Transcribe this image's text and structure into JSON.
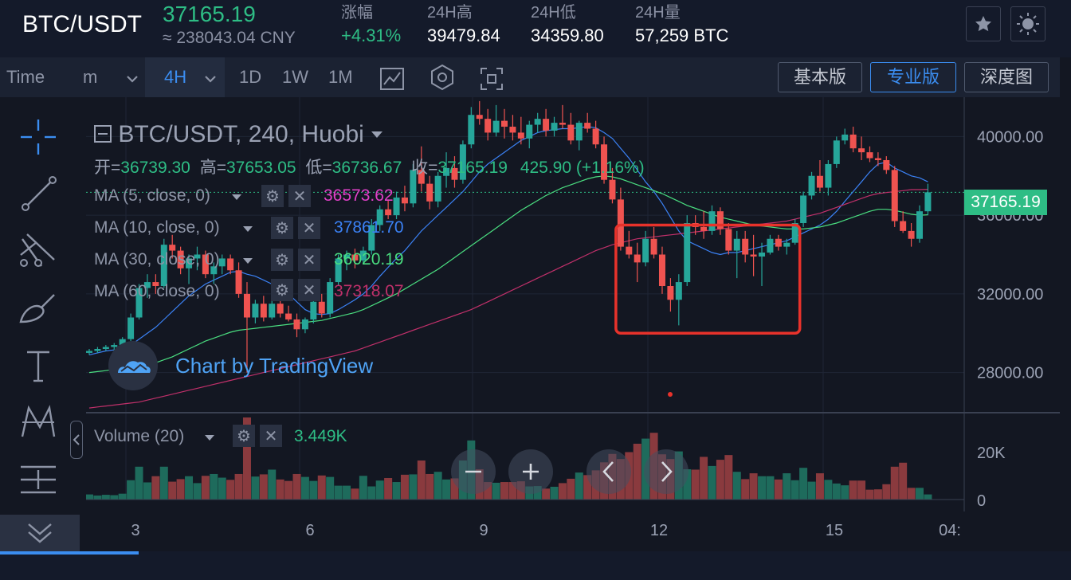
{
  "header": {
    "pair": "BTC/USDT",
    "last_price": "37165.19",
    "cny": "≈ 238043.04 CNY",
    "stats": [
      {
        "label": "涨幅",
        "value": "+4.31%",
        "color": "#2ebd85"
      },
      {
        "label": "24H高",
        "value": "39479.84",
        "color": "#ffffff"
      },
      {
        "label": "24H低",
        "value": "34359.80",
        "color": "#ffffff"
      },
      {
        "label": "24H量",
        "value": "57,259 BTC",
        "color": "#ffffff"
      }
    ]
  },
  "toolbar": {
    "time_label": "Time",
    "minute_label": "m",
    "interval_selected": "4H",
    "intervals": [
      "1D",
      "1W",
      "1M"
    ],
    "views": [
      "基本版",
      "专业版",
      "深度图"
    ],
    "active_view": "专业版"
  },
  "chart": {
    "title": "BTC/USDT, 240, Huobi",
    "ohlc": {
      "open_label": "开=",
      "open": "36739.30",
      "high_label": "高=",
      "high": "37653.05",
      "low_label": "低=",
      "low": "36736.67",
      "close_label": "收=",
      "close": "37165.19",
      "change": "425.90 (+1.16%)"
    },
    "ma": [
      {
        "label": "MA (5, close, 0)",
        "value": "36573.62",
        "color": "#e040c8"
      },
      {
        "label": "MA (10, close, 0)",
        "value": "37861.70",
        "color": "#3b82f6"
      },
      {
        "label": "MA (30, close, 0)",
        "value": "36020.19",
        "color": "#4ade80"
      },
      {
        "label": "MA (60, close, 0)",
        "value": "37318.07",
        "color": "#c0306a"
      }
    ],
    "watermark": "Chart by TradingView",
    "volume_label": "Volume (20)",
    "volume_value": "3.449K",
    "price_ticks": [
      "40000.00",
      "36000.00",
      "32000.00",
      "28000.00"
    ],
    "price_tag": "37165.19",
    "volume_ticks": [
      "20K",
      "0"
    ],
    "x_ticks": [
      "3",
      "6",
      "9",
      "12",
      "15",
      "04:"
    ]
  },
  "chart_data": {
    "type": "candlestick",
    "ylim": [
      26000,
      42000
    ],
    "candles": [
      [
        29000,
        29200,
        28900,
        29100
      ],
      [
        29100,
        29300,
        29000,
        29200
      ],
      [
        29200,
        29400,
        29100,
        29300
      ],
      [
        29300,
        29500,
        29100,
        29400
      ],
      [
        29400,
        29800,
        29300,
        29700
      ],
      [
        29700,
        31000,
        29600,
        30800
      ],
      [
        30800,
        32500,
        30700,
        32300
      ],
      [
        32300,
        33000,
        31800,
        32600
      ],
      [
        32600,
        33000,
        32000,
        32400
      ],
      [
        32400,
        34800,
        32300,
        34500
      ],
      [
        34500,
        35000,
        33800,
        34200
      ],
      [
        34200,
        34400,
        33000,
        33300
      ],
      [
        33300,
        34000,
        32500,
        33800
      ],
      [
        33800,
        34400,
        33200,
        34000
      ],
      [
        34000,
        34200,
        32800,
        33000
      ],
      [
        33000,
        33600,
        32500,
        33400
      ],
      [
        33400,
        34000,
        33000,
        33800
      ],
      [
        33800,
        34000,
        33000,
        33200
      ],
      [
        33200,
        33600,
        31800,
        32000
      ],
      [
        32000,
        32600,
        28000,
        30800
      ],
      [
        30800,
        31700,
        30500,
        31500
      ],
      [
        31500,
        31900,
        30600,
        30800
      ],
      [
        30800,
        31700,
        30700,
        31500
      ],
      [
        31500,
        31800,
        30800,
        31000
      ],
      [
        31000,
        31400,
        30600,
        30700
      ],
      [
        30700,
        31000,
        29800,
        30200
      ],
      [
        30200,
        30800,
        30000,
        30700
      ],
      [
        30700,
        31800,
        30500,
        31600
      ],
      [
        31600,
        32000,
        30800,
        31000
      ],
      [
        31000,
        32800,
        30800,
        32600
      ],
      [
        32600,
        34000,
        32400,
        33800
      ],
      [
        33800,
        34200,
        33200,
        34000
      ],
      [
        34000,
        34300,
        33300,
        33700
      ],
      [
        33700,
        34400,
        33500,
        34200
      ],
      [
        34200,
        35800,
        34000,
        35500
      ],
      [
        35500,
        36500,
        35200,
        36300
      ],
      [
        36300,
        36800,
        35800,
        36000
      ],
      [
        36000,
        37200,
        35800,
        36900
      ],
      [
        36900,
        37500,
        36200,
        36600
      ],
      [
        36600,
        38600,
        36400,
        38300
      ],
      [
        38300,
        39500,
        37200,
        37600
      ],
      [
        37600,
        38000,
        36300,
        36700
      ],
      [
        36700,
        38200,
        36400,
        38000
      ],
      [
        38000,
        39200,
        37400,
        38400
      ],
      [
        38400,
        39000,
        37400,
        37800
      ],
      [
        37800,
        39800,
        37600,
        39600
      ],
      [
        39600,
        41500,
        39400,
        41100
      ],
      [
        41100,
        41800,
        40600,
        40900
      ],
      [
        40900,
        41400,
        39800,
        40200
      ],
      [
        40200,
        41600,
        40000,
        40800
      ],
      [
        40800,
        41400,
        39900,
        40500
      ],
      [
        40500,
        41100,
        39800,
        40200
      ],
      [
        40200,
        41000,
        39600,
        39900
      ],
      [
        39900,
        40800,
        39400,
        40600
      ],
      [
        40600,
        41200,
        40200,
        40900
      ],
      [
        40900,
        41400,
        40000,
        40300
      ],
      [
        40300,
        41000,
        40000,
        40700
      ],
      [
        40700,
        41600,
        40400,
        40600
      ],
      [
        40600,
        41200,
        39600,
        39800
      ],
      [
        39800,
        40800,
        39300,
        40700
      ],
      [
        40700,
        41200,
        40200,
        40400
      ],
      [
        40400,
        40800,
        39400,
        39600
      ],
      [
        39600,
        40000,
        37600,
        37800
      ],
      [
        37800,
        38400,
        36600,
        36800
      ],
      [
        36800,
        37400,
        34200,
        34400
      ],
      [
        34400,
        35200,
        33800,
        34000
      ],
      [
        34000,
        34600,
        32600,
        33600
      ],
      [
        33600,
        35200,
        33400,
        34800
      ],
      [
        34800,
        35400,
        33800,
        34000
      ],
      [
        34000,
        34400,
        32000,
        32400
      ],
      [
        32400,
        32800,
        31100,
        31700
      ],
      [
        31700,
        33000,
        30400,
        32600
      ],
      [
        32600,
        36000,
        32400,
        35600
      ],
      [
        35600,
        36000,
        35000,
        35400
      ],
      [
        35400,
        36200,
        34800,
        35200
      ],
      [
        35200,
        36500,
        35000,
        36200
      ],
      [
        36200,
        36400,
        35000,
        35300
      ],
      [
        35300,
        35600,
        34000,
        34200
      ],
      [
        34200,
        35200,
        32800,
        34800
      ],
      [
        34800,
        35200,
        33600,
        34000
      ],
      [
        34000,
        35000,
        32900,
        33900
      ],
      [
        33900,
        34600,
        32400,
        34100
      ],
      [
        34100,
        35000,
        34000,
        34800
      ],
      [
        34800,
        35000,
        34200,
        34400
      ],
      [
        34400,
        34800,
        34000,
        34600
      ],
      [
        34600,
        35800,
        34500,
        35600
      ],
      [
        35600,
        37200,
        35400,
        37000
      ],
      [
        37000,
        38200,
        36800,
        38000
      ],
      [
        38000,
        38800,
        37200,
        37400
      ],
      [
        37400,
        38800,
        37000,
        38600
      ],
      [
        38600,
        40000,
        38400,
        39800
      ],
      [
        39800,
        40400,
        39600,
        40100
      ],
      [
        40100,
        40500,
        39200,
        39400
      ],
      [
        39400,
        40000,
        38800,
        39200
      ],
      [
        39200,
        39500,
        38700,
        38900
      ],
      [
        38900,
        39200,
        38500,
        38800
      ],
      [
        38800,
        39000,
        38100,
        38300
      ],
      [
        38300,
        38500,
        35400,
        35700
      ],
      [
        35700,
        36200,
        35100,
        35200
      ],
      [
        35200,
        35600,
        34400,
        34800
      ],
      [
        34800,
        36500,
        34600,
        36200
      ],
      [
        36200,
        37600,
        36000,
        37165
      ]
    ],
    "volumes": [
      1400,
      1100,
      1300,
      1200,
      1600,
      5300,
      9000,
      4700,
      6400,
      9000,
      4900,
      5600,
      6400,
      4500,
      6500,
      7000,
      6000,
      5400,
      7000,
      22500,
      6300,
      6900,
      8200,
      5500,
      5100,
      7000,
      6200,
      5100,
      6600,
      6200,
      3800,
      3800,
      3000,
      6500,
      3600,
      5200,
      5900,
      4800,
      6800,
      6900,
      10700,
      7000,
      7600,
      5500,
      5800,
      10700,
      16200,
      8300,
      4800,
      4600,
      4800,
      4800,
      5000,
      3600,
      3700,
      3000,
      3500,
      4500,
      5700,
      7400,
      6700,
      8000,
      10200,
      12500,
      11100,
      13000,
      15300,
      16700,
      18300,
      12400,
      11100,
      13200,
      8300,
      8200,
      11700,
      9200,
      10900,
      12200,
      7600,
      5600,
      7200,
      6400,
      6400,
      5500,
      7200,
      5300,
      8700,
      4900,
      7200,
      5400,
      4400,
      3900,
      5200,
      5200,
      2700,
      2800,
      4200,
      9000,
      10100,
      3200,
      3200,
      1400
    ],
    "ma_series": [
      {
        "name": "MA (10, close, 0)",
        "color": "#3b82f6",
        "values": [
          28900,
          29000,
          29100,
          29150,
          29250,
          29400,
          29700,
          30000,
          30300,
          30700,
          31100,
          31500,
          31900,
          32200,
          32500,
          32700,
          32900,
          33100,
          33150,
          33000,
          32900,
          32700,
          32500,
          32300,
          32000,
          31600,
          31200,
          31000,
          30950,
          31000,
          31200,
          31450,
          31700,
          32000,
          32400,
          32900,
          33350,
          33800,
          34200,
          34700,
          35200,
          35600,
          36000,
          36400,
          36800,
          37200,
          37700,
          38200,
          38600,
          38900,
          39200,
          39500,
          39800,
          40000,
          40200,
          40300,
          40350,
          40400,
          40400,
          40450,
          40500,
          40450,
          40200,
          39900,
          39400,
          38900,
          38300,
          37700,
          37200,
          36600,
          35900,
          35200,
          34700,
          34500,
          34300,
          34100,
          34000,
          34100,
          34100,
          34200,
          34300,
          34400,
          34500,
          34600,
          34700,
          34900,
          35100,
          35300,
          35500,
          35800,
          36200,
          36700,
          37200,
          37700,
          38200,
          38600,
          38700,
          38400,
          38200,
          38000,
          37900,
          37700
        ]
      },
      {
        "name": "MA (30, close, 0)",
        "color": "#4ade80",
        "values": [
          28000,
          28050,
          28100,
          28150,
          28200,
          28250,
          28300,
          28400,
          28500,
          28650,
          28800,
          29000,
          29200,
          29400,
          29600,
          29750,
          29900,
          30050,
          30150,
          30200,
          30250,
          30300,
          30350,
          30400,
          30450,
          30500,
          30550,
          30600,
          30650,
          30750,
          30850,
          30950,
          31050,
          31200,
          31400,
          31600,
          31800,
          32000,
          32250,
          32500,
          32750,
          33000,
          33250,
          33550,
          33850,
          34150,
          34450,
          34750,
          35050,
          35350,
          35650,
          35950,
          36250,
          36500,
          36750,
          37000,
          37200,
          37400,
          37550,
          37700,
          37850,
          37950,
          38000,
          37950,
          37850,
          37700,
          37550,
          37400,
          37250,
          37100,
          36900,
          36700,
          36500,
          36350,
          36200,
          36050,
          35900,
          35800,
          35700,
          35600,
          35500,
          35450,
          35400,
          35350,
          35300,
          35300,
          35300,
          35350,
          35400,
          35500,
          35600,
          35750,
          35900,
          36050,
          36200,
          36300,
          36300,
          36250,
          36150,
          36050,
          36000,
          36020
        ]
      },
      {
        "name": "MA (60, close, 0)",
        "color": "#c0306a",
        "values": [
          26200,
          26250,
          26300,
          26350,
          26400,
          26450,
          26500,
          26600,
          26700,
          26800,
          26900,
          27000,
          27100,
          27200,
          27300,
          27400,
          27500,
          27600,
          27700,
          27800,
          27900,
          28000,
          28100,
          28200,
          28300,
          28400,
          28500,
          28600,
          28700,
          28800,
          28900,
          29000,
          29100,
          29250,
          29400,
          29550,
          29700,
          29850,
          30000,
          30150,
          30300,
          30450,
          30600,
          30750,
          30900,
          31050,
          31200,
          31400,
          31600,
          31800,
          32000,
          32200,
          32400,
          32600,
          32800,
          33000,
          33200,
          33400,
          33600,
          33800,
          34000,
          34200,
          34350,
          34500,
          34600,
          34700,
          34800,
          34850,
          34900,
          34950,
          35000,
          35050,
          35100,
          35150,
          35200,
          35250,
          35300,
          35350,
          35400,
          35450,
          35500,
          35550,
          35600,
          35650,
          35700,
          35800,
          35900,
          36000,
          36100,
          36250,
          36400,
          36550,
          36700,
          36850,
          37000,
          37100,
          37150,
          37200,
          37250,
          37300,
          37300,
          37318
        ]
      }
    ],
    "highlight_box": {
      "from_candle": 64,
      "to_candle": 85,
      "low": 30000,
      "high": 35500
    }
  },
  "colors": {
    "up": "#26a69a",
    "down": "#ef5350",
    "accent": "#3b8df0",
    "price_tag": "#2ebd85",
    "highlight": "#e8322b"
  }
}
